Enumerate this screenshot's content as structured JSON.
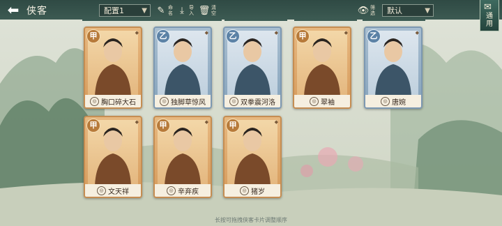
{
  "header": {
    "back": "⬅",
    "title": "侠客"
  },
  "config_select": {
    "value": "配置1"
  },
  "tools": [
    {
      "name": "rename",
      "icon": "✎",
      "label": "命名"
    },
    {
      "name": "import",
      "icon": "⤓",
      "label": "导入"
    },
    {
      "name": "clear",
      "icon": "🗑",
      "label": "清空"
    }
  ],
  "filter": {
    "icon": "👁",
    "label": "筛选"
  },
  "sort_select": {
    "value": "默认"
  },
  "apply": {
    "icon": "✉",
    "label": "通用"
  },
  "cards": [
    {
      "grade": "甲",
      "tier": "jia",
      "name": "胸口碎大石"
    },
    {
      "grade": "乙",
      "tier": "yi",
      "name": "独脚草惊风"
    },
    {
      "grade": "乙",
      "tier": "yi",
      "name": "双拳震河洛"
    },
    {
      "grade": "甲",
      "tier": "jia",
      "name": "翠袖"
    },
    {
      "grade": "乙",
      "tier": "yi",
      "name": "唐婉"
    },
    {
      "grade": "甲",
      "tier": "jia",
      "name": "文天祥"
    },
    {
      "grade": "甲",
      "tier": "jia",
      "name": "辛弃疾"
    },
    {
      "grade": "甲",
      "tier": "jia",
      "name": "猪岁"
    }
  ],
  "hint": "长按可拖拽侠客卡片调整顺序",
  "colors": {
    "jia": "#d69b5c",
    "yi": "#86a3bb",
    "topbar": "#2f4a44"
  }
}
